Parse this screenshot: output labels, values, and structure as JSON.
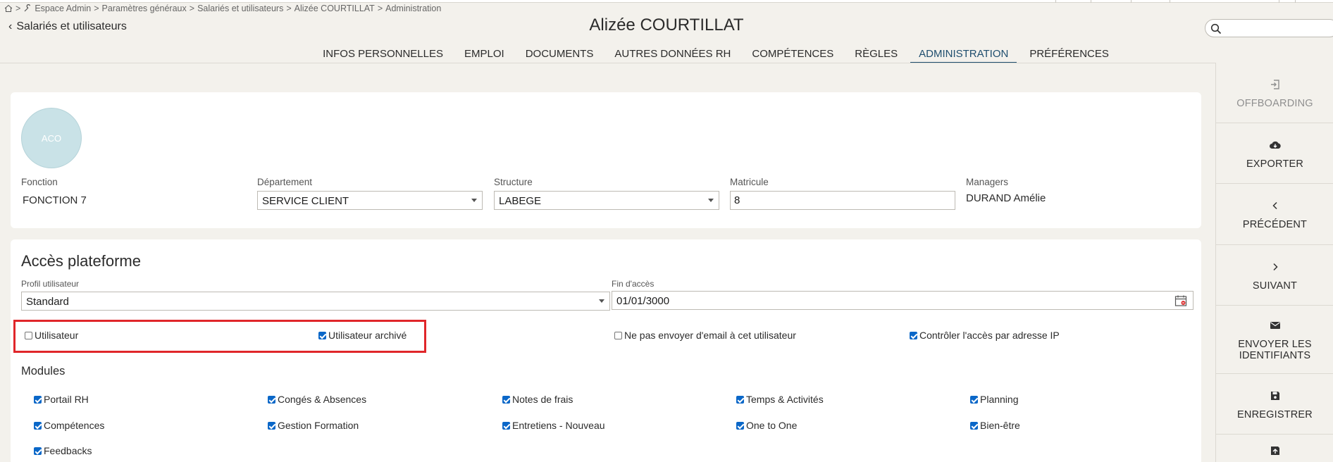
{
  "breadcrumb": {
    "items": [
      "Espace Admin",
      "Paramètres généraux",
      "Salariés et utilisateurs",
      "Alizée COURTILLAT",
      "Administration"
    ]
  },
  "header": {
    "back_label": "Salariés et utilisateurs",
    "title": "Alizée COURTILLAT",
    "search_placeholder": ""
  },
  "tabs": [
    {
      "label": "INFOS PERSONNELLES",
      "active": false
    },
    {
      "label": "EMPLOI",
      "active": false
    },
    {
      "label": "DOCUMENTS",
      "active": false
    },
    {
      "label": "AUTRES DONNÉES RH",
      "active": false
    },
    {
      "label": "COMPÉTENCES",
      "active": false
    },
    {
      "label": "RÈGLES",
      "active": false
    },
    {
      "label": "ADMINISTRATION",
      "active": true
    },
    {
      "label": "PRÉFÉRENCES",
      "active": false
    }
  ],
  "actions": {
    "offboarding": "OFFBOARDING",
    "exporter": "EXPORTER",
    "precedent": "PRÉCÉDENT",
    "suivant": "SUIVANT",
    "envoyer": "ENVOYER LES IDENTIFIANTS",
    "enregistrer": "ENREGISTRER"
  },
  "profile": {
    "avatar_initials": "ACO",
    "fonction_label": "Fonction",
    "fonction_value": "FONCTION 7",
    "departement_label": "Département",
    "departement_value": "SERVICE CLIENT",
    "structure_label": "Structure",
    "structure_value": "LABEGE",
    "matricule_label": "Matricule",
    "matricule_value": "8",
    "managers_label": "Managers",
    "managers_value": "DURAND Amélie"
  },
  "acces": {
    "title": "Accès plateforme",
    "profil_label": "Profil utilisateur",
    "profil_value": "Standard",
    "fin_label": "Fin d'accès",
    "fin_value": "01/01/3000",
    "options": {
      "utilisateur": {
        "label": "Utilisateur",
        "checked": false
      },
      "archive": {
        "label": "Utilisateur archivé",
        "checked": true
      },
      "no_email": {
        "label": "Ne pas envoyer d'email à cet utilisateur",
        "checked": false
      },
      "ip": {
        "label": "Contrôler l'accès par adresse IP",
        "checked": true
      }
    },
    "modules_title": "Modules",
    "modules": [
      {
        "label": "Portail RH",
        "checked": true
      },
      {
        "label": "Congés & Absences",
        "checked": true
      },
      {
        "label": "Notes de frais",
        "checked": true
      },
      {
        "label": "Temps & Activités",
        "checked": true
      },
      {
        "label": "Planning",
        "checked": true
      },
      {
        "label": "Compétences",
        "checked": true
      },
      {
        "label": "Gestion Formation",
        "checked": true
      },
      {
        "label": "Entretiens - Nouveau",
        "checked": true
      },
      {
        "label": "One to One",
        "checked": true
      },
      {
        "label": "Bien-être",
        "checked": true
      },
      {
        "label": "Feedbacks",
        "checked": true
      }
    ]
  }
}
